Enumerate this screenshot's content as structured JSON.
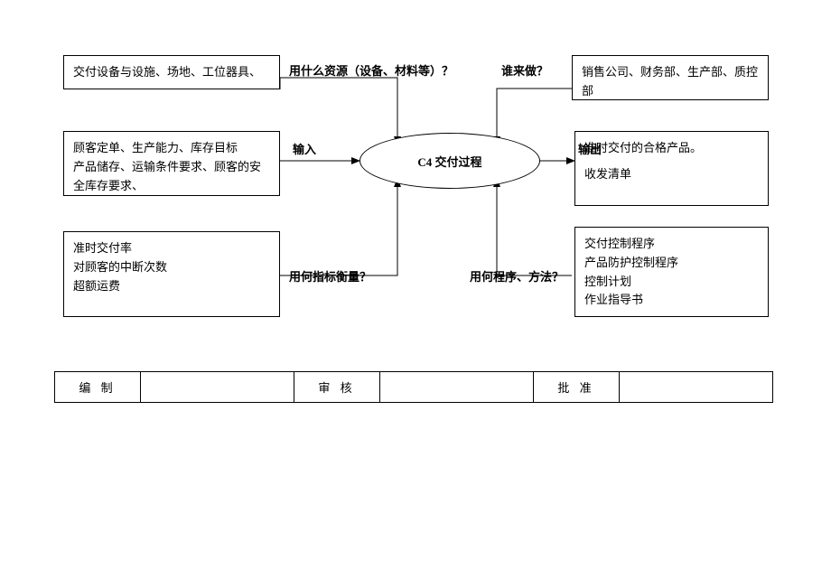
{
  "process": {
    "center": "C4 交付过程",
    "labels": {
      "resources": "用什么资源（设备、材料等）？",
      "who": "谁来做？",
      "input": "输入",
      "output": "输出",
      "metrics": "用何指标衡量？",
      "methods": "用何程序、方法？"
    },
    "boxes": {
      "resources": "交付设备与设施、场地、工位器具、",
      "who": "销售公司、财务部、生产部、质控部",
      "input_line1": "顾客定单、生产能力、库存目标",
      "input_line2": "产品储存、运输条件要求、顾客的安全库存要求、",
      "output_line1": "准时交付的合格产品。",
      "output_line2": "收发清单",
      "metrics_line1": "准时交付率",
      "metrics_line2": "对顾客的中断次数",
      "metrics_line3": "超额运费",
      "methods_line1": "交付控制程序",
      "methods_line2": "产品防护控制程序",
      "methods_line3": "控制计划",
      "methods_line4": "作业指导书"
    }
  },
  "signoff": {
    "prepare": "编 制",
    "review": "审 核",
    "approve": "批 准"
  }
}
